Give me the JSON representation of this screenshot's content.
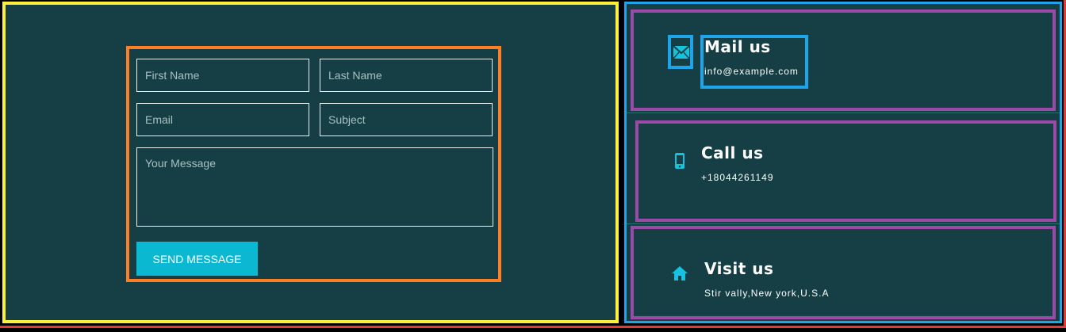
{
  "form": {
    "first_name_placeholder": "First Name",
    "last_name_placeholder": "Last Name",
    "email_placeholder": "Email",
    "subject_placeholder": "Subject",
    "message_placeholder": "Your Message",
    "send_label": "SEND MESSAGE"
  },
  "contact": {
    "mail": {
      "title": "Mail us",
      "text": "info@example.com",
      "icon": "envelope-icon"
    },
    "call": {
      "title": "Call us",
      "text": "+18044261149",
      "icon": "phone-icon"
    },
    "visit": {
      "title": "Visit us",
      "text": "Stir vally,New york,U.S.A",
      "icon": "home-icon"
    }
  },
  "colors": {
    "panel_bg": "#153f44",
    "accent": "#0ab8d1",
    "outline_yellow": "#fdf03a",
    "outline_orange": "#ff7f27",
    "outline_purple": "#9c4aa8",
    "outline_blue": "#1ea5e9",
    "outline_red": "#e53935"
  }
}
